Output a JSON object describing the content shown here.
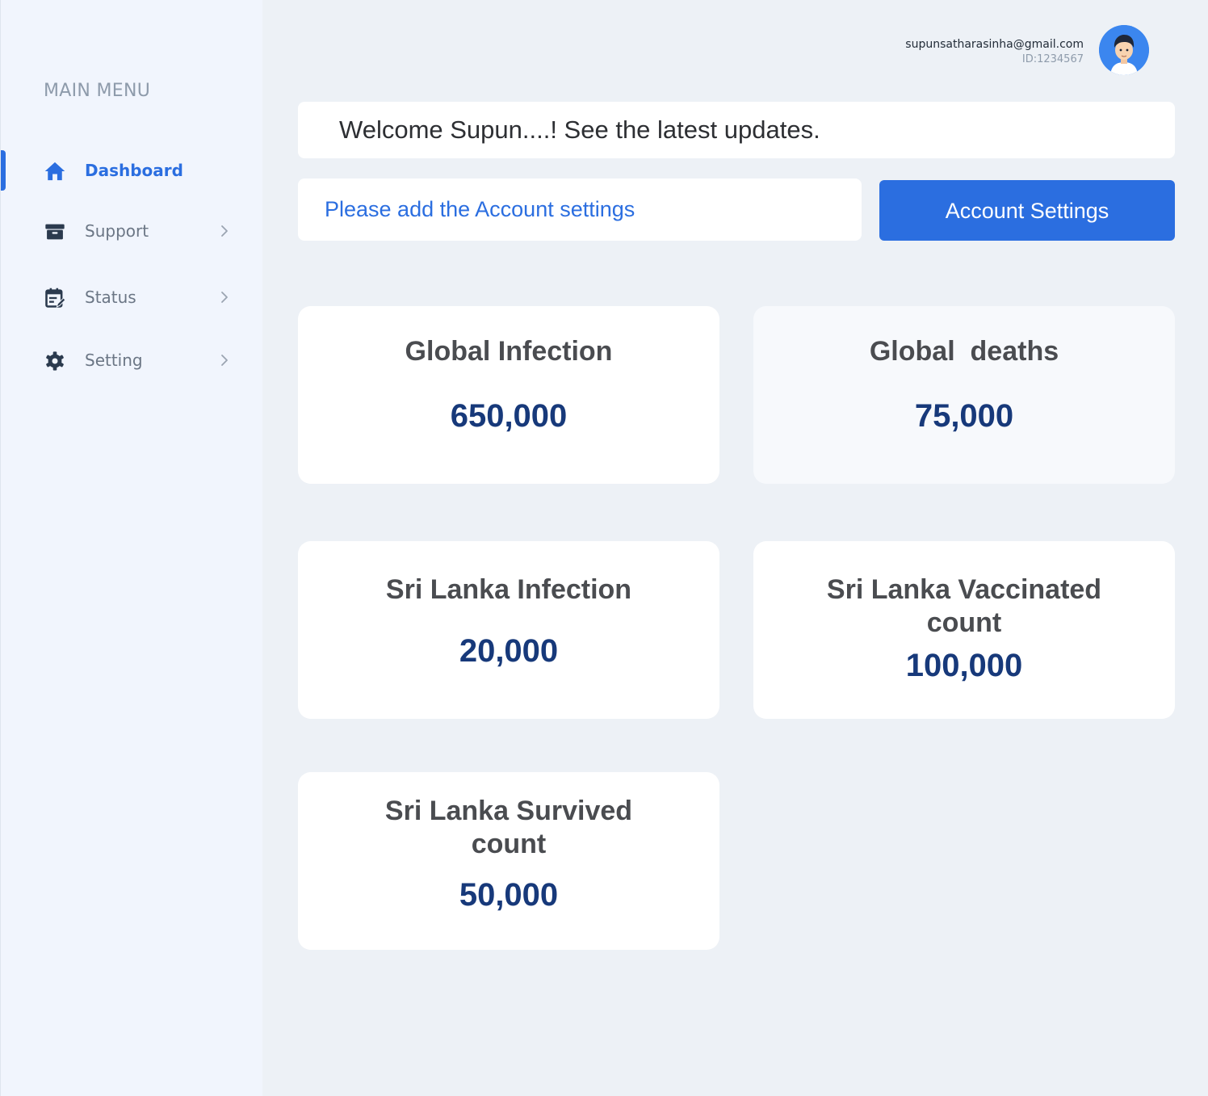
{
  "sidebar": {
    "title": "MAIN MENU",
    "items": [
      {
        "label": "Dashboard",
        "icon": "home-icon",
        "active": true
      },
      {
        "label": "Support",
        "icon": "archive-icon"
      },
      {
        "label": "Status",
        "icon": "calendar-edit-icon"
      },
      {
        "label": "Setting",
        "icon": "gear-icon"
      }
    ]
  },
  "user": {
    "email": "supunsatharasinha@gmail.com",
    "id": "ID:1234567",
    "avatar_icon": "user-avatar"
  },
  "welcome": "Welcome Supun....! See the latest updates.",
  "notice": "Please add the Account settings",
  "account_button": "Account Settings",
  "cards": [
    {
      "title": "Global Infection",
      "value": "650,000"
    },
    {
      "title": "Global  deaths",
      "value": "75,000"
    },
    {
      "title": "Sri Lanka Infection",
      "value": "20,000"
    },
    {
      "title": "Sri Lanka Vaccinated count",
      "value": "100,000"
    },
    {
      "title": "Sri Lanka Survived count",
      "value": "50,000"
    }
  ],
  "colors": {
    "accent": "#2b6ee0",
    "value": "#17397a",
    "background": "#edf1f6",
    "sidebar": "#f1f5fd"
  }
}
